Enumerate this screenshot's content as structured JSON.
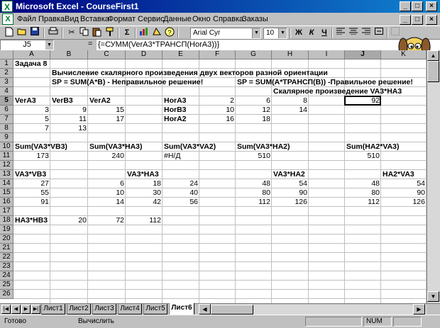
{
  "window": {
    "title": "Microsoft Excel - CourseFirst1",
    "app_icon": "excel-icon"
  },
  "menu": [
    "Файл",
    "Правка",
    "Вид",
    "Вставка",
    "Формат",
    "Сервис",
    "Данные",
    "Окно",
    "Справка",
    "Заказы"
  ],
  "toolbar": {
    "font_name": "Arial Cyr",
    "font_size": "10",
    "bold": "Ж",
    "italic": "К",
    "underline": "Ч",
    "sum": "Σ"
  },
  "formula_bar": {
    "cell_ref": "J5",
    "equals": "=",
    "formula": "{=СУММ(VerA3*ТРАНСП(HorA3))}"
  },
  "grid": {
    "columns": [
      "A",
      "B",
      "C",
      "D",
      "E",
      "F",
      "G",
      "H",
      "I",
      "J",
      "K"
    ],
    "rows": [
      "1",
      "2",
      "3",
      "4",
      "5",
      "6",
      "7",
      "8",
      "9",
      "10",
      "11",
      "12",
      "13",
      "14",
      "15",
      "16",
      "17",
      "18",
      "19",
      "20",
      "21",
      "22",
      "23",
      "24",
      "25",
      "26"
    ],
    "active_cell": "J5"
  },
  "cells": {
    "A1": "Задача 8",
    "B2": "Вычисление скалярного произведения двух векторов разной ориентации",
    "B3": "SP = SUM(A*B) - Неправильное решение!",
    "G3": "SP = SUM(A*ТРАНСП(B)) -Правильное решение!",
    "H4": "Скалярное произведение VA3*HA3",
    "A5": "VerA3",
    "B5": "VerB3",
    "C5": "VerA2",
    "E5": "HorA3",
    "F5": "2",
    "G5": "6",
    "H5": "8",
    "J5": "92",
    "A6": "3",
    "B6": "9",
    "C6": "15",
    "E6": "HorB3",
    "F6": "10",
    "G6": "12",
    "H6": "14",
    "A7": "5",
    "B7": "11",
    "C7": "17",
    "E7": "HorA2",
    "F7": "16",
    "G7": "18",
    "A8": "7",
    "B8": "13",
    "A10": "Sum(VA3*VB3)",
    "C10": "Sum(VA3*HA3)",
    "E10": "Sum(VA3*VA2)",
    "G10": "Sum(VA3*HA2)",
    "J10": "Sum(HA2*VA3)",
    "A11": "173",
    "C11": "240",
    "E11": "#Н/Д",
    "G11": "510",
    "J11": "510",
    "A13": "VA3*VB3",
    "D13": "VA3*HA3",
    "H13": "VA3*HA2",
    "K13": "HA2*VA3",
    "A14": "27",
    "C14": "6",
    "D14": "18",
    "E14": "24",
    "G14": "48",
    "H14": "54",
    "J14": "48",
    "K14": "54",
    "A15": "55",
    "C15": "10",
    "D15": "30",
    "E15": "40",
    "G15": "80",
    "H15": "90",
    "J15": "80",
    "K15": "90",
    "A16": "91",
    "C16": "14",
    "D16": "42",
    "E16": "56",
    "G16": "112",
    "H16": "126",
    "J16": "112",
    "K16": "126",
    "A18": "HA3*HB3",
    "B18": "20",
    "C18": "72",
    "D18": "112"
  },
  "sheets": [
    "Лист1",
    "Лист2",
    "Лист3",
    "Лист4",
    "Лист5",
    "Лист6"
  ],
  "active_sheet": "Лист6",
  "status": {
    "ready": "Готово",
    "calculate": "Вычислить",
    "num": "NUM"
  },
  "colors": {
    "title_start": "#000080",
    "title_end": "#1084d0",
    "chrome": "#c0c0c0",
    "grid": "#c0c0c0"
  }
}
